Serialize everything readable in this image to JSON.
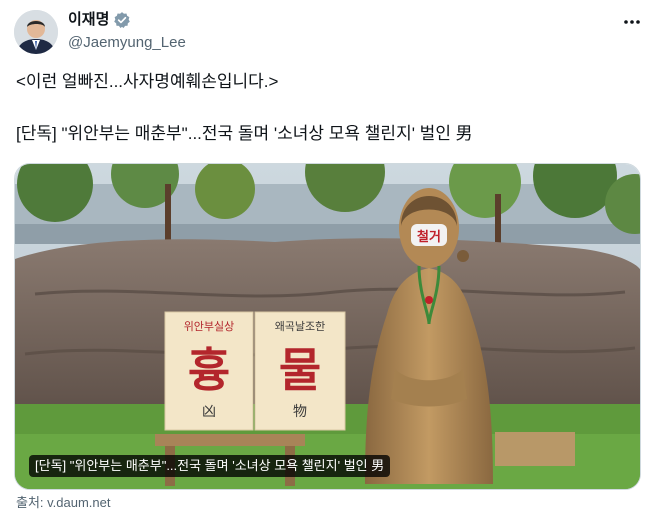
{
  "author": {
    "display_name": "이재명",
    "handle": "@Jaemyung_Lee"
  },
  "icons": {
    "verified": "verified-badge-icon",
    "more": "more-options-icon"
  },
  "tweet": {
    "line1": "<이런 얼빠진...사자명예훼손입니다.>",
    "line2": "[단독] \"위안부는 매춘부\"...전국 돌며 '소녀상 모욕 챌린지' 벌인 男"
  },
  "card": {
    "caption": "[단독] \"위안부는 매춘부\"...전국 돌며 '소녀상 모욕 챌린지' 벌인 男",
    "sign_left_top": "위안부실상",
    "sign_left_big": "흉",
    "sign_left_hanja": "凶",
    "sign_right_top": "왜곡날조한",
    "sign_right_big": "물",
    "sign_right_hanja": "物",
    "mask_text": "철거"
  },
  "source": "출처: v.daum.net",
  "colors": {
    "verified": "#829aab",
    "caption_bg": "#000000",
    "sign_bg": "#f3e6c8",
    "sign_text": "#b3262c"
  }
}
